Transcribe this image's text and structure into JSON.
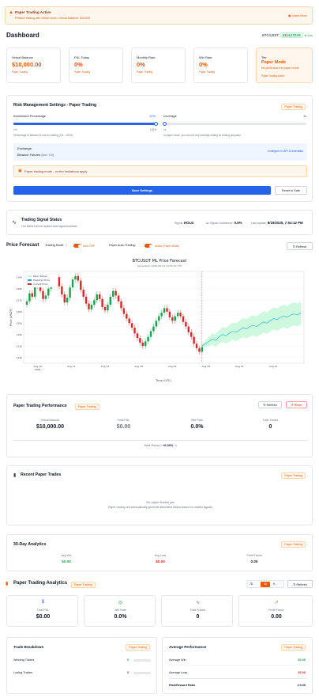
{
  "banner": {
    "title": "Paper Trading Active",
    "subtitle": "Practice trading with virtual funds • Virtual Balance: $10,000",
    "learn_more": "Learn More"
  },
  "header": {
    "title": "Dashboard",
    "pair": "BTC/USDT:",
    "price": "$114,272.91",
    "change": "▼ Live"
  },
  "stats": [
    {
      "label": "Virtual Balance",
      "value": "$10,000.00",
      "sub": "Paper Trading"
    },
    {
      "label": "P&L Today",
      "value": "0%",
      "sub": "Paper Trading"
    },
    {
      "label": "Monthly Rate",
      "value": "0%",
      "sub": "Paper Trading"
    },
    {
      "label": "Win Rate",
      "value": "0%",
      "sub": "Paper Trading"
    },
    {
      "label": "Tier",
      "value": "Paper Mode",
      "note": "No profit share in paper mode",
      "sub": "Paper Trading Active"
    }
  ],
  "risk": {
    "title": "Risk Management Settings - Paper Trading",
    "badge": "Paper Trading",
    "inv_label": "Investment Percentage",
    "inv_value": "10%",
    "inv_min": "1%",
    "inv_max": "100%",
    "inv_fill": 0.98,
    "inv_help": "Percentage of balance to use for trading (1% - 100%)",
    "lev_label": "Leverage",
    "lev_value": "1x",
    "lev_min": "1x",
    "lev_fill": 0.0,
    "lev_help": "In paper mode, you can use any leverage setting for testing purposes",
    "exchange_label": "Exchange:",
    "exchange_value": "Binance Futures",
    "exchange_note": "(Max: 10x)",
    "configure": "Configure in API Credentials",
    "notice": "Paper trading mode - no tier limitations apply",
    "save": "Save Settings",
    "reset": "Reset to Safe"
  },
  "signal": {
    "title": "Trading Signal Status",
    "subtitle": "Live status from the system-wide signal broadcast",
    "signal_label": "Signal:",
    "signal_value": "HOLD",
    "conf_label": "AI Signal Confidence:",
    "conf_value": "0.5%",
    "update_label": "Last update:",
    "update_value": "8/19/2025, 7:54:12 PM"
  },
  "forecast": {
    "title": "Price Forecast",
    "mode_label": "Trading Mode:",
    "mode_value": "Sure OFF",
    "auto_label": "Paper Auto-Trading:",
    "auto_value": "Active (Paper Mode)",
    "refresh": "Refresh"
  },
  "chart_data": {
    "type": "line",
    "title": "BTCUSDT ML Price Forecast",
    "subtitle": "Generated: 2025-08-19 19:54:00 UTC",
    "xlabel": "Time (UTC)",
    "ylabel": "Price (USDT)",
    "legend": [
      "Paper Range",
      "Predicted Price",
      "Current Price"
    ],
    "x_ticks": [
      "Aug 10\n2025",
      "Aug 11",
      "Aug 12",
      "Aug 18",
      "Aug 19",
      "Aug 20",
      "Aug 21",
      "Aug 22"
    ],
    "y_ticks": [
      "119k",
      "118k",
      "117k",
      "116k",
      "115k",
      "114k",
      "113k",
      "112k"
    ],
    "ylim": [
      111500,
      119500
    ],
    "candles": [
      116900,
      117600,
      117300,
      118200,
      118500,
      117800,
      117100,
      117400,
      118000,
      118600,
      118400,
      119000,
      118200,
      117500,
      116800,
      117200,
      118100,
      118800,
      119100,
      118700,
      117900,
      117300,
      116700,
      116200,
      116600,
      117000,
      117500,
      117100,
      116400,
      116100,
      116600,
      117300,
      117800,
      117400,
      116900,
      116300,
      115800,
      115400,
      115000,
      114600,
      114100,
      113700,
      113300,
      113000,
      113400,
      113800,
      114300,
      114700,
      115200,
      115600,
      115900,
      116300,
      116000,
      115500,
      115200,
      115600,
      115900,
      115600,
      115100,
      114700,
      114200,
      113800,
      113200,
      112800,
      112500,
      112900
    ],
    "forecast": [
      113000,
      113200,
      113400,
      113600,
      113500,
      113800,
      114000,
      113900,
      114100,
      114300,
      114200,
      114400,
      114600,
      114500,
      114700,
      114800,
      114700,
      114900,
      115100,
      115000,
      115200,
      115400,
      115300,
      115500,
      115600,
      115500,
      115700,
      115800,
      115700,
      115900
    ],
    "band_width": [
      200,
      300,
      400,
      500,
      550,
      600,
      650,
      700,
      720,
      750,
      780,
      800,
      820,
      850,
      870,
      880,
      900,
      920,
      930,
      940,
      950,
      960,
      970,
      980,
      990,
      1000,
      1000,
      1000,
      1000,
      1000
    ]
  },
  "performance": {
    "title": "Paper Trading Performance",
    "badge": "Paper Trading",
    "refresh": "Refresh",
    "reset": "Reset",
    "items": [
      {
        "label": "Virtual Balance",
        "value": "$10,000.00"
      },
      {
        "label": "Total P&L",
        "value": "$0.00"
      },
      {
        "label": "Win Rate",
        "value": "0.0%"
      },
      {
        "label": "Total Trades",
        "value": "0"
      }
    ],
    "total_return_label": "Total Return:",
    "total_return_value": "+0.00%"
  },
  "recent": {
    "title": "Recent Paper Trades",
    "badge": "Paper Trading",
    "empty_title": "No paper trades yet",
    "empty_sub": "Paper trading will automatically generate simulated trades based on market signals"
  },
  "analytics30": {
    "title": "30-Day Analytics",
    "badge": "Paper Trading",
    "items": [
      {
        "label": "Avg Win",
        "value": "$0.00"
      },
      {
        "label": "Avg Loss",
        "value": "$0.00"
      },
      {
        "label": "Profit Factor",
        "value": "0.00"
      }
    ]
  },
  "analytics": {
    "title": "Paper Trading Analytics",
    "badge": "Paper Trading",
    "tabs": [
      "7D",
      "30",
      "9..."
    ],
    "refresh": "Refresh",
    "cards": [
      {
        "label": "Total P&L",
        "value": "$0.00",
        "icon": "$"
      },
      {
        "label": "Win Rate",
        "value": "0.0%",
        "icon": "◎"
      },
      {
        "label": "Total Trades",
        "value": "0",
        "icon": "∿"
      },
      {
        "label": "Profit Factor",
        "value": "0.00",
        "icon": "↗"
      }
    ]
  },
  "breakdown": {
    "title": "Trade Breakdown",
    "badge": "Paper Trading",
    "rows": [
      {
        "label": "Winning Trades",
        "value": "0"
      },
      {
        "label": "Losing Trades",
        "value": "0"
      }
    ]
  },
  "avgperf": {
    "title": "Average Performance",
    "badge": "Paper Trading",
    "rows": [
      {
        "label": "Average Win",
        "value": "$0.00"
      },
      {
        "label": "Average Loss",
        "value": "$0.00"
      },
      {
        "label": "Risk/Reward Ratio",
        "value": "1:0.00"
      }
    ]
  }
}
